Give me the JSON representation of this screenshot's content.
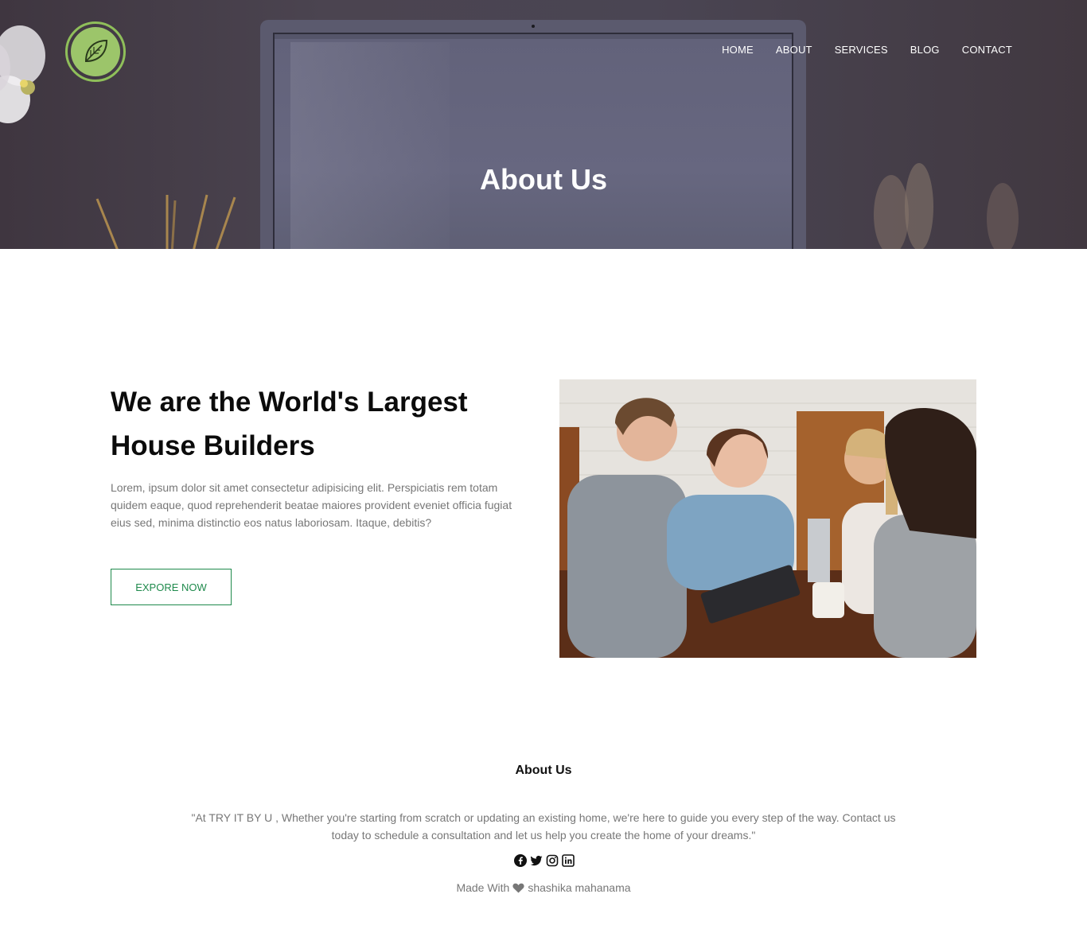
{
  "nav": {
    "items": [
      "HOME",
      "ABOUT",
      "SERVICES",
      "BLOG",
      "CONTACT"
    ]
  },
  "hero": {
    "title": "About Us"
  },
  "about": {
    "heading": "We are the World's Largest House Builders",
    "text": "Lorem, ipsum dolor sit amet consectetur adipisicing elit. Perspiciatis rem totam quidem eaque, quod reprehenderit beatae maiores provident eveniet officia fugiat eius sed, minima distinctio eos natus laboriosam. Itaque, debitis?",
    "button_label": "EXPORE NOW"
  },
  "footer": {
    "title": "About Us",
    "quote": "\"At TRY IT BY U , Whether you're starting from scratch or updating an existing home, we're here to guide you every step of the way. Contact us today to schedule a consultation and let us help you create the home of your dreams.\"",
    "socials": [
      "facebook-icon",
      "twitter-icon",
      "instagram-icon",
      "linkedin-icon"
    ],
    "credit_prefix": "Made With",
    "credit_name": "shashika mahanama"
  },
  "colors": {
    "accent_green": "#1f8a4c",
    "logo_green": "#9cc56a",
    "hero_bg": "#4a4553"
  }
}
